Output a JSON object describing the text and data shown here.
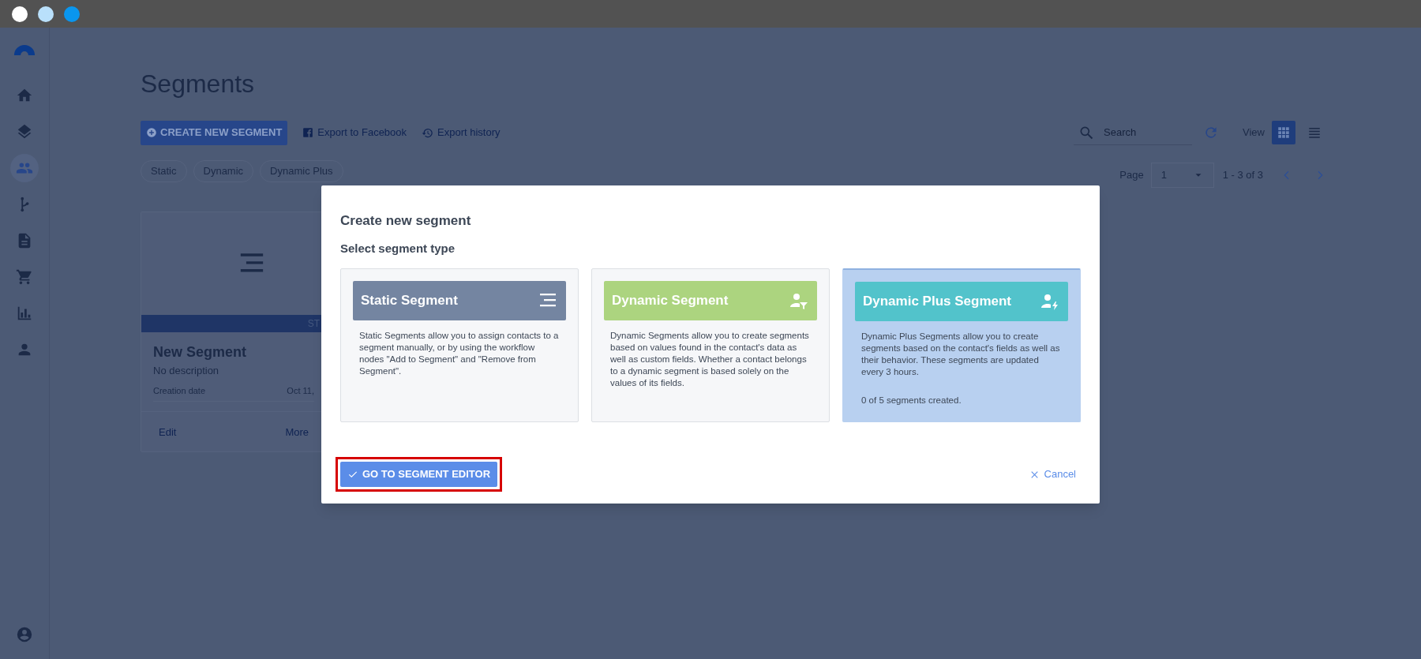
{
  "window": {
    "dots": [
      {
        "color": "#ffffff"
      },
      {
        "color": "#b9e0fb"
      },
      {
        "color": "#0a96ee"
      }
    ]
  },
  "sidebar": {
    "items": [
      {
        "kind": "home",
        "selected": false
      },
      {
        "kind": "layers",
        "selected": false
      },
      {
        "kind": "people",
        "selected": true
      },
      {
        "kind": "branch",
        "selected": false
      },
      {
        "kind": "document",
        "selected": false
      },
      {
        "kind": "cart",
        "selected": false
      },
      {
        "kind": "chart",
        "selected": false
      },
      {
        "kind": "person",
        "selected": false
      }
    ]
  },
  "page": {
    "title": "Segments",
    "toolbar": {
      "create_button": "CREATE NEW SEGMENT",
      "links": [
        {
          "kind": "facebook",
          "label": "Export to Facebook"
        },
        {
          "kind": "history",
          "label": "Export history"
        }
      ],
      "search": {
        "placeholder": "Search"
      },
      "view": {
        "label": "View",
        "options": [
          {
            "kind": "grid",
            "selected": true
          },
          {
            "kind": "list",
            "selected": false
          }
        ]
      }
    },
    "filters": [
      {
        "label": "Static"
      },
      {
        "label": "Dynamic"
      },
      {
        "label": "Dynamic Plus"
      }
    ],
    "pagination": {
      "label": "Page",
      "value": "1",
      "range": "1 - 3 of 3"
    },
    "segment_card": {
      "band": "ST",
      "name": "New Segment",
      "description": "No description",
      "field_label": "Creation date",
      "field_value": "Oct 11,",
      "actions": [
        "Edit",
        "More"
      ]
    }
  },
  "dialog": {
    "title": "Create new segment",
    "subtitle": "Select segment type",
    "options": [
      {
        "kind": "static",
        "title": "Static Segment",
        "color": "#7485a1",
        "selected": false,
        "description": "Static Segments allow you to assign contacts to a segment manually, or by using the workflow nodes \"Add to Segment\" and \"Remove from Segment\"."
      },
      {
        "kind": "dynamic",
        "title": "Dynamic Segment",
        "color": "#acd47f",
        "selected": false,
        "description": "Dynamic Segments allow you to create segments based on values found in the contact's data as well as custom fields. Whether a contact belongs to a dynamic segment is based solely on the values of its fields."
      },
      {
        "kind": "dynamic_plus",
        "title": "Dynamic Plus Segment",
        "color": "#52c3cb",
        "selected": true,
        "description": "Dynamic Plus Segments allow you to create segments based on the contact's fields as well as their behavior. These segments are updated every 3 hours.",
        "note": "0 of 5 segments created."
      }
    ],
    "confirm_button": {
      "label": "GO TO SEGMENT EDITOR",
      "highlighted": true
    },
    "cancel_button": "Cancel"
  }
}
